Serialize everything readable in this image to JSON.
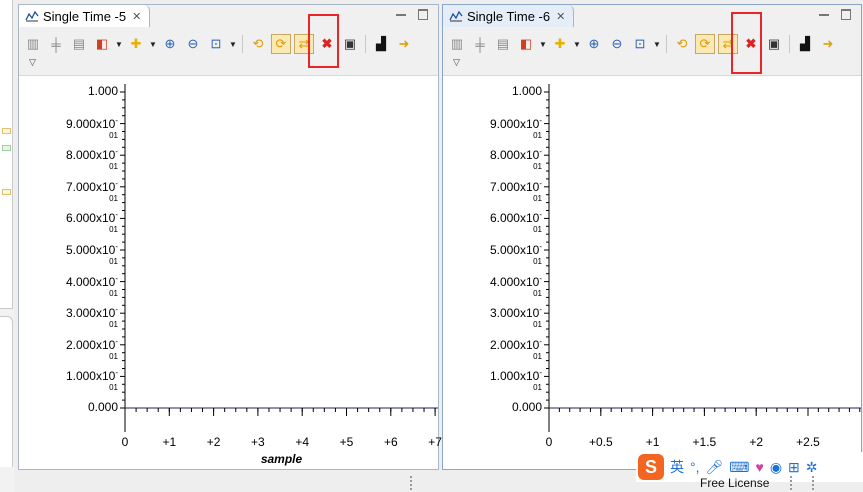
{
  "views": [
    {
      "id": "view1",
      "tab_title": "Single Time -5",
      "x_axis": {
        "ticks": [
          "0",
          "+1",
          "+2",
          "+3",
          "+4",
          "+5",
          "+6",
          "+7"
        ],
        "title": "sample"
      },
      "y_axis": {
        "ticks": [
          "0.000",
          "1.000x10-01",
          "2.000x10-01",
          "3.000x10-01",
          "4.000x10-01",
          "5.000x10-01",
          "6.000x10-01",
          "7.000x10-01",
          "8.000x10-01",
          "9.000x10-01",
          "1.000"
        ]
      }
    },
    {
      "id": "view2",
      "tab_title": "Single Time -6",
      "x_axis": {
        "ticks": [
          "0",
          "+0.5",
          "+1",
          "+1.5",
          "+2",
          "+2.5"
        ],
        "title": ""
      },
      "y_axis": {
        "ticks": [
          "0.000",
          "1.000x10-01",
          "2.000x10-01",
          "3.000x10-01",
          "4.000x10-01",
          "5.000x10-01",
          "6.000x10-01",
          "7.000x10-01",
          "8.000x10-01",
          "9.000x10-01",
          "1.000"
        ]
      }
    }
  ],
  "toolbar_icons": [
    "align-left-icon",
    "align-center-icon",
    "align-right-icon",
    "marker-icon",
    "add-series-icon",
    "zoom-in-icon",
    "zoom-out-icon",
    "zoom-box-icon",
    "refresh-icon",
    "auto-scale-icon",
    "auto-scale-all-icon",
    "delete-icon",
    "export-icon",
    "find-icon",
    "forward-icon"
  ],
  "ime_bar": {
    "mode_label": "英",
    "logo_letter": "S"
  },
  "status": {
    "license_text": "Free License"
  },
  "colors": {
    "highlight_box": "#e8262a",
    "plot_background": "#ffffff",
    "active_tab": "#e4edf8"
  }
}
